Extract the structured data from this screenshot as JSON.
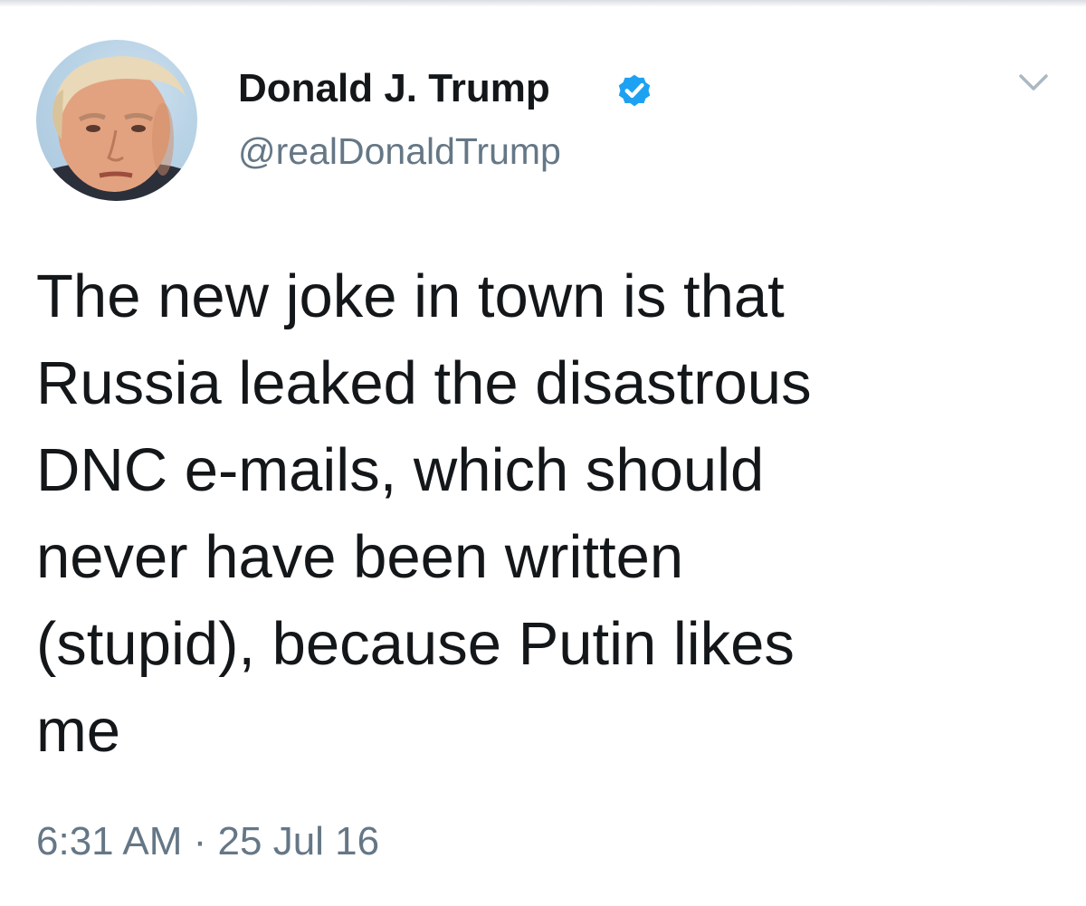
{
  "tweet": {
    "display_name": "Donald J. Trump",
    "handle": "@realDonaldTrump",
    "verified_icon": "verified-badge-icon",
    "menu_icon": "chevron-down-icon",
    "avatar_icon": "profile-avatar",
    "text": "The new joke in town is that\nRussia leaked the disastrous\nDNC e-mails, which should\nnever have been written\n(stupid), because Putin likes\nme",
    "timestamp": "6:31 AM · 25 Jul 16"
  },
  "colors": {
    "text_primary": "#14171a",
    "text_secondary": "#657786",
    "verified_blue": "#1da1f2",
    "background": "#ffffff"
  }
}
